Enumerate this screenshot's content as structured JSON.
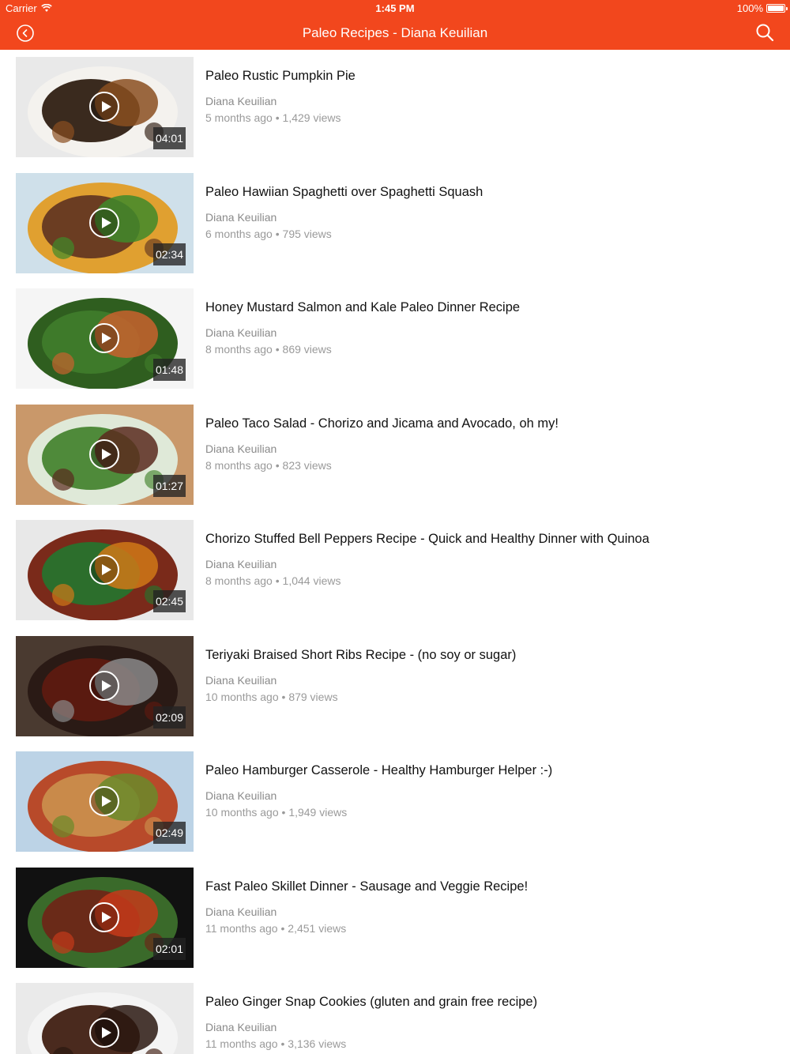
{
  "status_bar": {
    "carrier": "Carrier",
    "time": "1:45 PM",
    "battery": "100%"
  },
  "nav": {
    "title": "Paleo Recipes - Diana Keuilian"
  },
  "colors": {
    "accent": "#f2471d"
  },
  "videos": [
    {
      "title": "Paleo Rustic Pumpkin Pie",
      "author": "Diana Keuilian",
      "age": "5 months ago",
      "views": "1,429 views",
      "duration": "04:01"
    },
    {
      "title": "Paleo Hawiian Spaghetti over Spaghetti Squash",
      "author": "Diana Keuilian",
      "age": "6 months ago",
      "views": "795 views",
      "duration": "02:34"
    },
    {
      "title": "Honey Mustard Salmon and Kale Paleo Dinner Recipe",
      "author": "Diana Keuilian",
      "age": "8 months ago",
      "views": "869 views",
      "duration": "01:48"
    },
    {
      "title": "Paleo Taco Salad - Chorizo and Jicama and Avocado, oh my!",
      "author": "Diana Keuilian",
      "age": "8 months ago",
      "views": "823 views",
      "duration": "01:27"
    },
    {
      "title": "Chorizo Stuffed Bell Peppers Recipe - Quick and Healthy Dinner with Quinoa",
      "author": "Diana Keuilian",
      "age": "8 months ago",
      "views": "1,044 views",
      "duration": "02:45"
    },
    {
      "title": "Teriyaki Braised Short Ribs Recipe - (no soy or sugar)",
      "author": "Diana Keuilian",
      "age": "10 months ago",
      "views": "879 views",
      "duration": "02:09"
    },
    {
      "title": "Paleo Hamburger Casserole - Healthy Hamburger Helper :-)",
      "author": "Diana Keuilian",
      "age": "10 months ago",
      "views": "1,949 views",
      "duration": "02:49"
    },
    {
      "title": "Fast Paleo Skillet Dinner - Sausage and Veggie Recipe!",
      "author": "Diana Keuilian",
      "age": "11 months ago",
      "views": "2,451 views",
      "duration": "02:01"
    },
    {
      "title": "Paleo Ginger Snap Cookies (gluten and grain free recipe)",
      "author": "Diana Keuilian",
      "age": "11 months ago",
      "views": "3,136 views",
      "duration": ""
    }
  ]
}
